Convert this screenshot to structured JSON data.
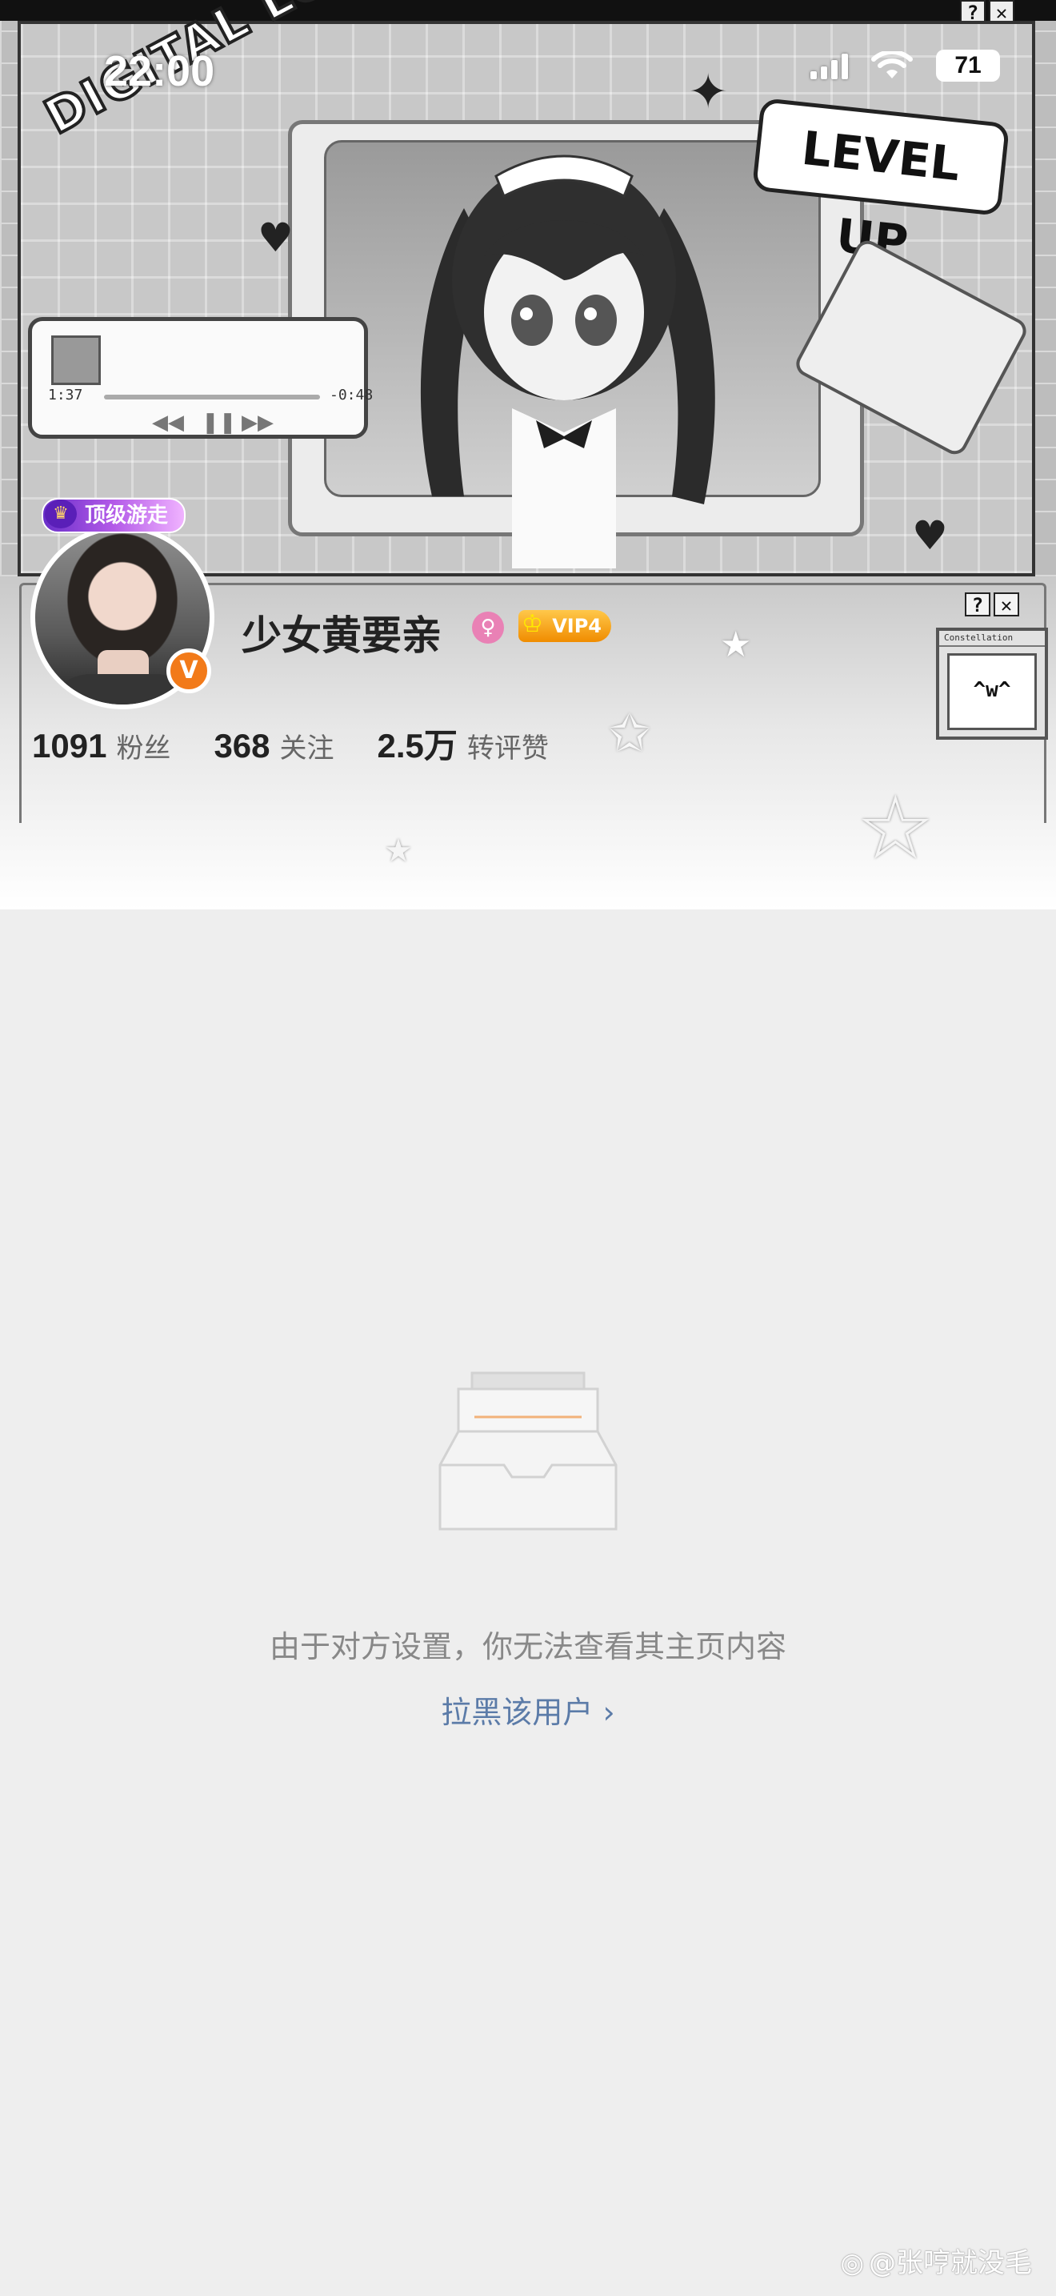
{
  "status_bar": {
    "time": "22:00",
    "battery": "71"
  },
  "banner": {
    "art_text_1": "DIGITAL LOVE",
    "art_text_2": "LEVEL UP",
    "player_time_start": "1:37",
    "player_time_end": "-0:48",
    "constellation_title": "Constellation",
    "constellation_face": "^w^"
  },
  "window_buttons": {
    "help": "?",
    "close": "✕"
  },
  "profile": {
    "tag": "顶级游走",
    "username": "少女黄要亲",
    "vip": "VIP4",
    "verified_mark": "V",
    "gender": "♀",
    "stats": [
      {
        "value": "1091",
        "label": "粉丝"
      },
      {
        "value": "368",
        "label": "关注"
      },
      {
        "value": "2.5万",
        "label": "转评赞"
      }
    ]
  },
  "empty_state": {
    "message": "由于对方设置，你无法查看其主页内容",
    "block_link": "拉黑该用户 ›"
  },
  "watermark": "@张哼就没毛"
}
